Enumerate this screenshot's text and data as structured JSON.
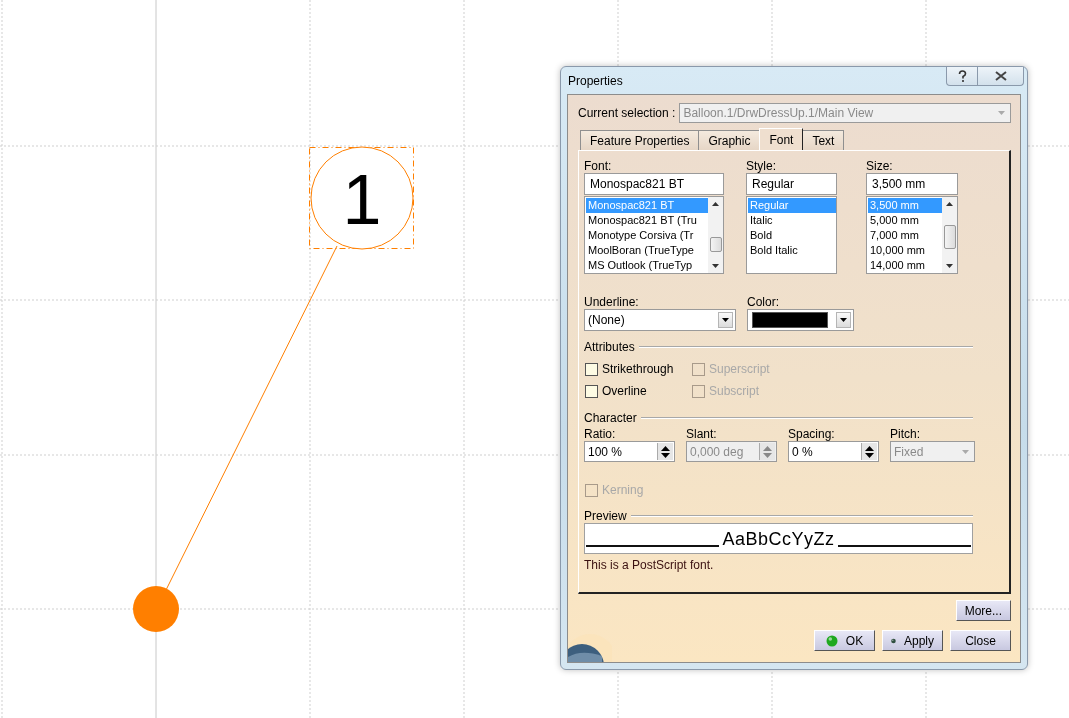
{
  "canvas": {
    "balloon": {
      "label": "1",
      "selected": true
    }
  },
  "window": {
    "title": "Properties"
  },
  "current_selection": {
    "label": "Current selection :",
    "value": "Balloon.1/DrwDressUp.1/Main View",
    "disabled": true
  },
  "tabs": [
    {
      "label": "Feature Properties",
      "selected": false
    },
    {
      "label": "Graphic",
      "selected": false
    },
    {
      "label": "Font",
      "selected": true
    },
    {
      "label": "Text",
      "selected": false
    }
  ],
  "font_lists": [
    {
      "label": "Font:",
      "value": "Monospac821 BT",
      "items": [
        {
          "text": "Monospac821 BT",
          "selected": true
        },
        {
          "text": "Monospac821 BT (Tru",
          "selected": false
        },
        {
          "text": "Monotype Corsiva (Tr",
          "selected": false
        },
        {
          "text": "MoolBoran (TrueType",
          "selected": false
        },
        {
          "text": "MS Outlook (TrueTyp",
          "selected": false
        }
      ],
      "scroll": true
    },
    {
      "label": "Style:",
      "value": "Regular",
      "items": [
        {
          "text": "Regular",
          "selected": true
        },
        {
          "text": "Italic",
          "selected": false
        },
        {
          "text": "Bold",
          "selected": false
        },
        {
          "text": "Bold Italic",
          "selected": false
        }
      ],
      "scroll": false
    },
    {
      "label": "Size:",
      "value": "3,500 mm",
      "items": [
        {
          "text": "3,500 mm",
          "selected": true
        },
        {
          "text": "5,000 mm",
          "selected": false
        },
        {
          "text": "7,000 mm",
          "selected": false
        },
        {
          "text": "10,000 mm",
          "selected": false
        },
        {
          "text": "14,000 mm",
          "selected": false
        }
      ],
      "scroll": true
    }
  ],
  "underline": {
    "label": "Underline:",
    "value": "(None)"
  },
  "color": {
    "label": "Color:",
    "color": "#000000"
  },
  "attributes": {
    "title": "Attributes",
    "checkboxes": [
      {
        "label": "Strikethrough",
        "checked": false,
        "disabled": false
      },
      {
        "label": "Superscript",
        "checked": false,
        "disabled": true
      },
      {
        "label": "Overline",
        "checked": false,
        "disabled": false
      },
      {
        "label": "Subscript",
        "checked": false,
        "disabled": true
      }
    ]
  },
  "character": {
    "title": "Character",
    "fields": [
      {
        "label": "Ratio:",
        "value": "100 %",
        "kind": "spinner",
        "disabled": false
      },
      {
        "label": "Slant:",
        "value": "0,000 deg",
        "kind": "spinner",
        "disabled": true
      },
      {
        "label": "Spacing:",
        "value": "0 %",
        "kind": "spinner",
        "disabled": false
      },
      {
        "label": "Pitch:",
        "value": "Fixed",
        "kind": "dropdown",
        "disabled": true
      }
    ]
  },
  "kerning": {
    "label": "Kerning",
    "checked": false,
    "disabled": true
  },
  "preview": {
    "title": "Preview",
    "sample": "AaBbCcYyZz",
    "note": "This is a PostScript font."
  },
  "more_button": {
    "label": "More..."
  },
  "actions": [
    {
      "label": "OK",
      "kind": "ok"
    },
    {
      "label": "Apply",
      "kind": "apply"
    },
    {
      "label": "Close",
      "kind": "plain"
    }
  ]
}
